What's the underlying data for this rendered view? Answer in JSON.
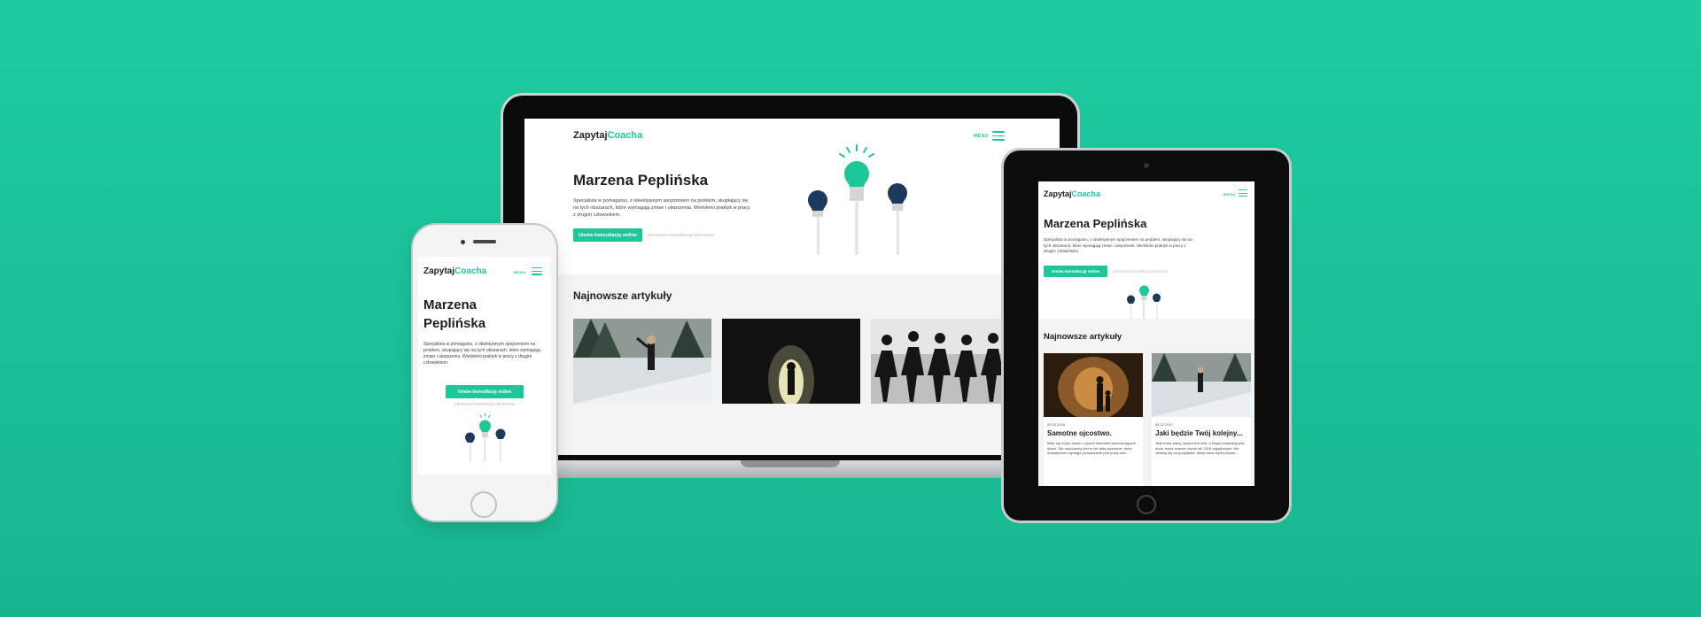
{
  "brand": {
    "prefix": "Zapytaj",
    "accent": "Coacha"
  },
  "nav": {
    "menu_label": "MENU"
  },
  "hero": {
    "name": "Marzena Peplińska",
    "name_line1": "Marzena",
    "name_line2": "Peplińska",
    "description": "Specjalista w pomaganiu, z obiektywnym spojrzeniem na problem, skupiający się na tych obszarach, które wymagają zmian i ulepszenia. Wieloletni praktyk w pracy z drugim człowiekiem.",
    "cta_label": "Umów konsultację online",
    "secondary_label": "pierwsza konsultacja darmowa"
  },
  "articles": {
    "heading": "Najnowsze artykuły",
    "items": [
      {
        "date": "25.03.2018",
        "title": "Samotne ojcostwo.",
        "excerpt": "Mało się mówi i pisze o ojcach samotnie wychowujących dzieci. Dla mężczyzny jest to nie lada wyzwanie, które empatycznie wymaga prowadzenie pod pracy nich"
      },
      {
        "date": "08.12.2017",
        "title": "Jaki będzie Twój kolejny...",
        "excerpt": "Jeśli masz plany, wytyczone cele, a twoja motywacja jest duża, masz szanse ucynić rok 2018 wyjątkowym. Nie zdziwię się na przypadek, kiedy wiesz lepiej ruszać..."
      }
    ]
  },
  "colors": {
    "background": "#1ecb9f",
    "accent": "#1ec79a",
    "dark_bulb": "#1d3a5c",
    "text": "#1f1f1f"
  }
}
